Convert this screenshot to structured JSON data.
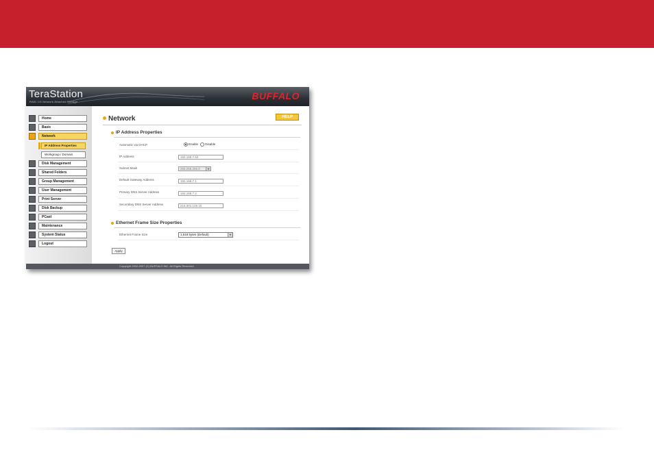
{
  "app": {
    "logo": "TeraStation",
    "logo_sub": "RAID 1/5 Network Attached Storage",
    "brand": "BUFFALO",
    "footer": "Copyright 2002-2007 (C) BUFFALO INC. All Rights Reserved."
  },
  "colors": {
    "top_band": "#c5202c",
    "accent": "#e7a617",
    "brand_red": "#e1232b"
  },
  "sidebar": {
    "items": [
      {
        "label": "Home",
        "icon": "home-icon",
        "active": false
      },
      {
        "label": "Basic",
        "icon": "basic-icon",
        "active": false
      },
      {
        "label": "Network",
        "icon": "network-icon",
        "active": true
      },
      {
        "label": "Disk Management",
        "icon": "disk-icon",
        "active": false
      },
      {
        "label": "Shared Folders",
        "icon": "folder-icon",
        "active": false
      },
      {
        "label": "Group Management",
        "icon": "group-icon",
        "active": false
      },
      {
        "label": "User Management",
        "icon": "user-icon",
        "active": false
      },
      {
        "label": "Print Server",
        "icon": "printer-icon",
        "active": false
      },
      {
        "label": "Disk Backup",
        "icon": "backup-icon",
        "active": false
      },
      {
        "label": "PCast",
        "icon": "pcast-icon",
        "active": false
      },
      {
        "label": "Maintenance",
        "icon": "maintenance-icon",
        "active": false
      },
      {
        "label": "System Status",
        "icon": "status-icon",
        "active": false
      },
      {
        "label": "Logout",
        "icon": "logout-icon",
        "active": false
      }
    ],
    "subitems": [
      {
        "label": "IP Address Properties",
        "active": true
      },
      {
        "label": "Workgroup / Domain",
        "active": false
      }
    ]
  },
  "main": {
    "title": "Network",
    "help_label": "HELP",
    "ip_section": {
      "title": "IP Address Properties",
      "dhcp_label": "Automatic via DHCP",
      "dhcp_options": [
        "Enable",
        "Disable"
      ],
      "dhcp_selected": "Enable",
      "ip_label": "IP Address",
      "ip_value": "192.168.7.60",
      "mask_label": "Subnet Mask",
      "mask_value": "255.255.255.0",
      "gateway_label": "Default Gateway Address",
      "gateway_value": "192.168.7.1",
      "dns1_label": "Primary DNS Server Address",
      "dns1_value": "192.168.7.2",
      "dns2_label": "Secondary DNS Server Address",
      "dns2_value": "216.301.129.10"
    },
    "frame_section": {
      "title": "Ethernet Frame Size Properties",
      "frame_label": "Ethernet Frame Size",
      "frame_value": "1,518 bytes (Default)"
    },
    "apply_label": "Apply"
  }
}
